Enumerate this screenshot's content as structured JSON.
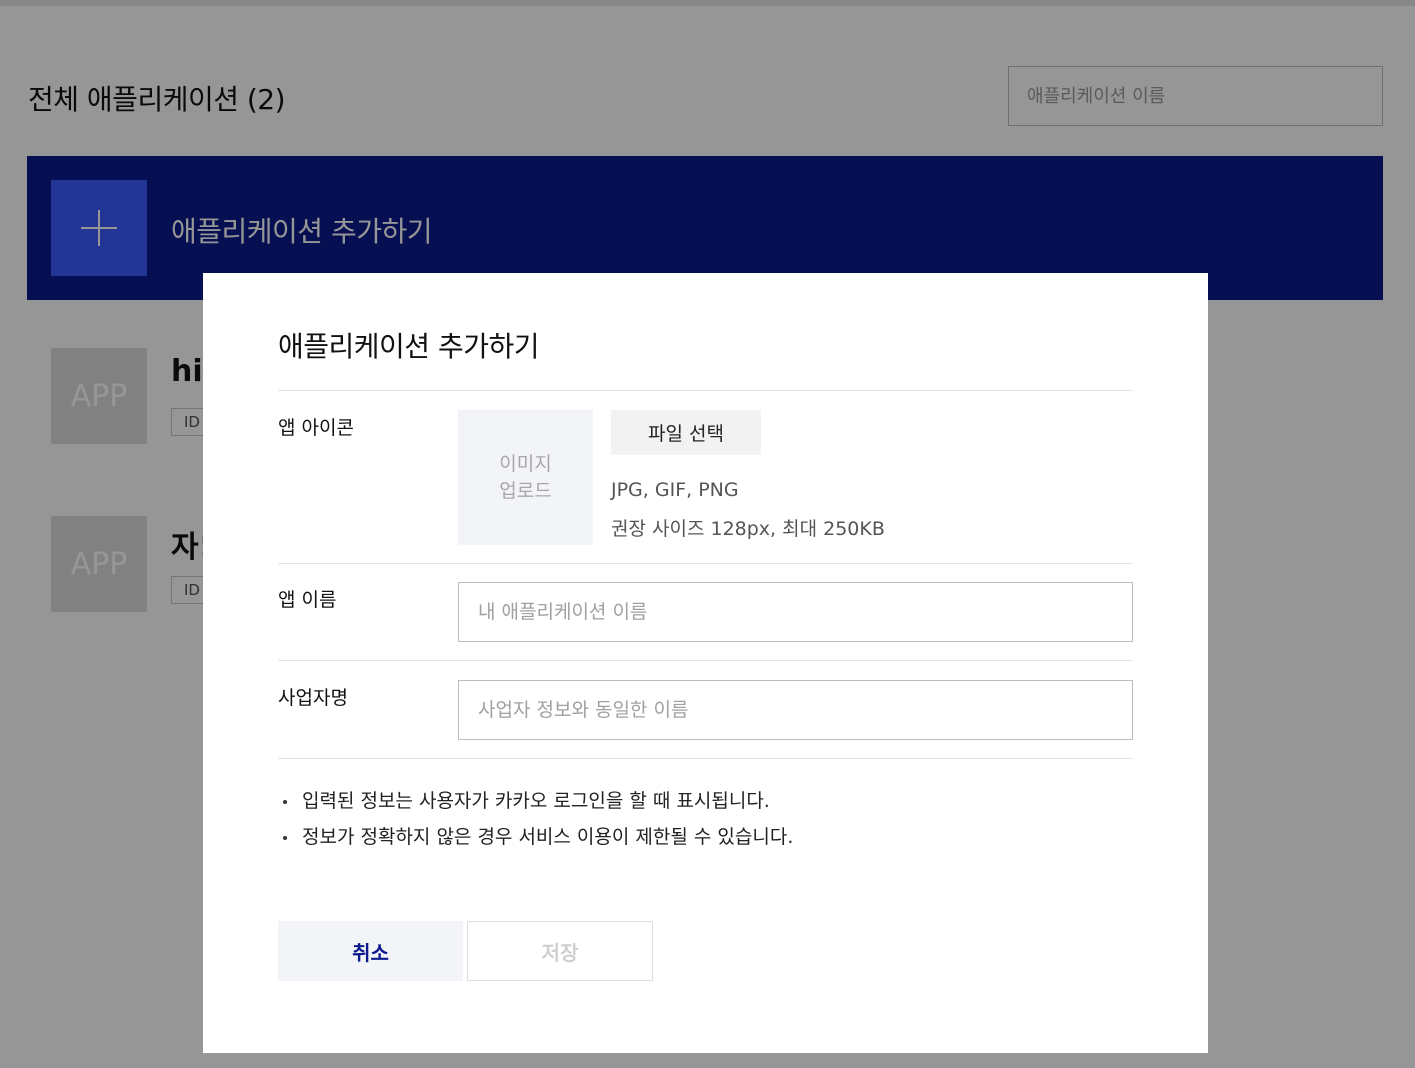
{
  "page": {
    "title": "전체 애플리케이션 (2)",
    "search": {
      "placeholder": "애플리케이션 이름",
      "value": ""
    },
    "add_banner": {
      "label": "애플리케이션 추가하기"
    },
    "apps": [
      {
        "thumb": "APP",
        "name": "hif",
        "id_label": "ID"
      },
      {
        "thumb": "APP",
        "name": "자!",
        "id_label": "ID"
      }
    ]
  },
  "modal": {
    "title": "애플리케이션 추가하기",
    "icon_row": {
      "label": "앱 아이콘",
      "upload_line1": "이미지",
      "upload_line2": "업로드",
      "file_button": "파일 선택",
      "hint_formats": "JPG, GIF, PNG",
      "hint_size": "권장 사이즈 128px, 최대 250KB"
    },
    "name_row": {
      "label": "앱 이름",
      "placeholder": "내 애플리케이션 이름",
      "value": ""
    },
    "company_row": {
      "label": "사업자명",
      "placeholder": "사업자 정보와 동일한 이름",
      "value": ""
    },
    "notes": [
      "입력된 정보는 사용자가 카카오 로그인을 할 때 표시됩니다.",
      "정보가 정확하지 않은 경우 서비스 이용이 제한될 수 있습니다."
    ],
    "buttons": {
      "cancel": "취소",
      "save": "저장"
    }
  },
  "colors": {
    "banner": "#0a1a8c",
    "plus_tile": "#3d5afe",
    "cancel_text": "#0a1a8c"
  }
}
